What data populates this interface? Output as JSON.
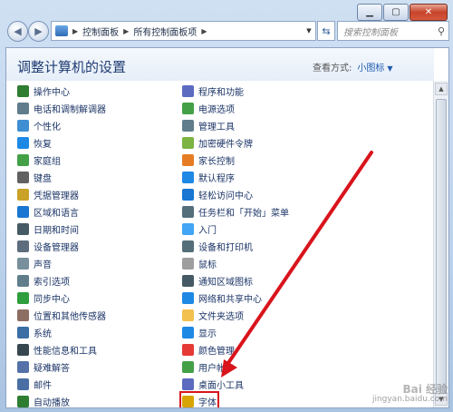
{
  "window": {
    "buttons": {
      "minimize": "▁",
      "maximize": "▢",
      "close": "✕"
    }
  },
  "nav": {
    "back": "◀",
    "forward": "▶",
    "address": [
      "控制面板",
      "所有控制面板项"
    ],
    "search_placeholder": "搜索控制面板"
  },
  "header": {
    "title": "调整计算机的设置",
    "view_by_label": "查看方式:",
    "view_by_value": "小图标"
  },
  "items_left": [
    {
      "label": "操作中心",
      "icon": "flag-icon",
      "color": "#2e7d32"
    },
    {
      "label": "电话和调制解调器",
      "icon": "phone-icon",
      "color": "#607d8b"
    },
    {
      "label": "个性化",
      "icon": "personalize-icon",
      "color": "#3f8fd2"
    },
    {
      "label": "恢复",
      "icon": "recovery-icon",
      "color": "#1e88e5"
    },
    {
      "label": "家庭组",
      "icon": "homegroup-icon",
      "color": "#43a047"
    },
    {
      "label": "键盘",
      "icon": "keyboard-icon",
      "color": "#616161"
    },
    {
      "label": "凭据管理器",
      "icon": "credential-icon",
      "color": "#c9a227"
    },
    {
      "label": "区域和语言",
      "icon": "globe-icon",
      "color": "#1976d2"
    },
    {
      "label": "日期和时间",
      "icon": "clock-icon",
      "color": "#455a64"
    },
    {
      "label": "设备管理器",
      "icon": "device-manager-icon",
      "color": "#5d6d7e"
    },
    {
      "label": "声音",
      "icon": "speaker-icon",
      "color": "#78909c"
    },
    {
      "label": "索引选项",
      "icon": "index-icon",
      "color": "#607d8b"
    },
    {
      "label": "同步中心",
      "icon": "sync-icon",
      "color": "#2e9e3e"
    },
    {
      "label": "位置和其他传感器",
      "icon": "sensor-icon",
      "color": "#8d6e63"
    },
    {
      "label": "系统",
      "icon": "system-icon",
      "color": "#3a6ea5"
    },
    {
      "label": "性能信息和工具",
      "icon": "performance-icon",
      "color": "#37474f"
    },
    {
      "label": "疑难解答",
      "icon": "troubleshoot-icon",
      "color": "#5472a8"
    },
    {
      "label": "邮件",
      "icon": "mail-icon",
      "color": "#4a6fa5"
    },
    {
      "label": "自动播放",
      "icon": "autoplay-icon",
      "color": "#2e7d32"
    }
  ],
  "items_right": [
    {
      "label": "程序和功能",
      "icon": "programs-icon",
      "color": "#5c6bc0"
    },
    {
      "label": "电源选项",
      "icon": "power-icon",
      "color": "#43a047"
    },
    {
      "label": "管理工具",
      "icon": "admin-tools-icon",
      "color": "#607d8b"
    },
    {
      "label": "加密硬件令牌",
      "icon": "token-icon",
      "color": "#7cb342"
    },
    {
      "label": "家长控制",
      "icon": "parental-icon",
      "color": "#e57c24"
    },
    {
      "label": "默认程序",
      "icon": "default-programs-icon",
      "color": "#1e88e5"
    },
    {
      "label": "轻松访问中心",
      "icon": "ease-access-icon",
      "color": "#1976d2"
    },
    {
      "label": "任务栏和「开始」菜单",
      "icon": "taskbar-icon",
      "color": "#546e7a"
    },
    {
      "label": "入门",
      "icon": "getting-started-icon",
      "color": "#42a5f5"
    },
    {
      "label": "设备和打印机",
      "icon": "printer-icon",
      "color": "#546e7a"
    },
    {
      "label": "鼠标",
      "icon": "mouse-icon",
      "color": "#9e9e9e"
    },
    {
      "label": "通知区域图标",
      "icon": "notify-icon",
      "color": "#455a64"
    },
    {
      "label": "网络和共享中心",
      "icon": "network-icon",
      "color": "#1e88e5"
    },
    {
      "label": "文件夹选项",
      "icon": "folder-icon",
      "color": "#f2c14e"
    },
    {
      "label": "显示",
      "icon": "display-icon",
      "color": "#1e88e5"
    },
    {
      "label": "颜色管理",
      "icon": "color-mgmt-icon",
      "color": "#e53935"
    },
    {
      "label": "用户帐户",
      "icon": "user-accounts-icon",
      "color": "#43a047"
    },
    {
      "label": "桌面小工具",
      "icon": "gadgets-icon",
      "color": "#5c6bc0"
    },
    {
      "label": "字体",
      "icon": "font-icon",
      "color": "#d8a400"
    }
  ],
  "annotation": {
    "arrow_color": "#d9141c"
  },
  "watermark": {
    "line1": "Bai 经验",
    "line2": "jingyan.baidu.com"
  }
}
